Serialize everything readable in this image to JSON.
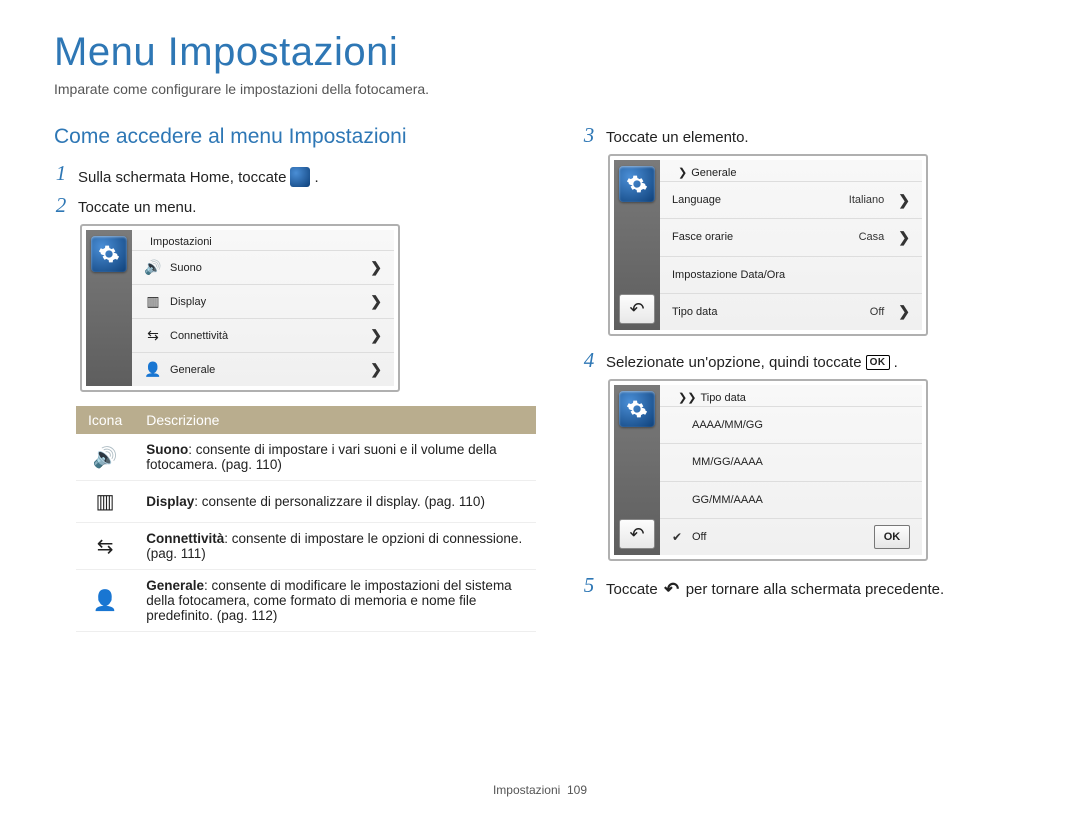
{
  "page": {
    "title": "Menu Impostazioni",
    "subtitle": "Imparate come configurare le impostazioni della fotocamera.",
    "section_heading": "Come accedere al menu Impostazioni"
  },
  "steps": {
    "s1": {
      "num": "1",
      "text_before": "Sulla schermata Home, toccate",
      "text_after": "."
    },
    "s2": {
      "num": "2",
      "text": "Toccate un menu."
    },
    "s3": {
      "num": "3",
      "text": "Toccate un elemento."
    },
    "s4": {
      "num": "4",
      "text_before": "Selezionate un'opzione, quindi toccate",
      "text_after": "."
    },
    "s5": {
      "num": "5",
      "text_before": "Toccate",
      "text_after": "per tornare alla schermata precedente."
    }
  },
  "screen_impostazioni": {
    "title": "Impostazioni",
    "rows": [
      {
        "icon": "sound-icon",
        "label": "Suono"
      },
      {
        "icon": "display-icon",
        "label": "Display"
      },
      {
        "icon": "connect-icon",
        "label": "Connettività"
      },
      {
        "icon": "user-icon",
        "label": "Generale"
      }
    ]
  },
  "screen_generale": {
    "title": "Generale",
    "rows": [
      {
        "label": "Language",
        "value": "Italiano",
        "chevron": true
      },
      {
        "label": "Fasce orarie",
        "value": "Casa",
        "chevron": true
      },
      {
        "label": "Impostazione Data/Ora",
        "value": "",
        "chevron": false
      },
      {
        "label": "Tipo data",
        "value": "Off",
        "chevron": true
      }
    ]
  },
  "screen_tipodata": {
    "title": "Tipo data",
    "options": [
      {
        "label": "AAAA/MM/GG",
        "checked": false
      },
      {
        "label": "MM/GG/AAAA",
        "checked": false
      },
      {
        "label": "GG/MM/AAAA",
        "checked": false
      },
      {
        "label": "Off",
        "checked": true
      }
    ],
    "ok": "OK"
  },
  "desc_table": {
    "head_icon": "Icona",
    "head_desc": "Descrizione",
    "rows": [
      {
        "icon": "sound-icon",
        "bold": "Suono",
        "rest": ": consente di impostare i vari suoni e il volume della fotocamera. (pag. 110)"
      },
      {
        "icon": "display-icon",
        "bold": "Display",
        "rest": ": consente di personalizzare il display. (pag. 110)"
      },
      {
        "icon": "connect-icon",
        "bold": "Connettività",
        "rest": ": consente di impostare le opzioni di connessione. (pag. 111)"
      },
      {
        "icon": "user-icon",
        "bold": "Generale",
        "rest": ": consente di modificare le impostazioni del sistema della fotocamera, come formato di memoria e nome file predefinito. (pag. 112)"
      }
    ]
  },
  "glyphs": {
    "ok": "OK",
    "back": "↶"
  },
  "footer": {
    "section": "Impostazioni",
    "page": "109"
  }
}
